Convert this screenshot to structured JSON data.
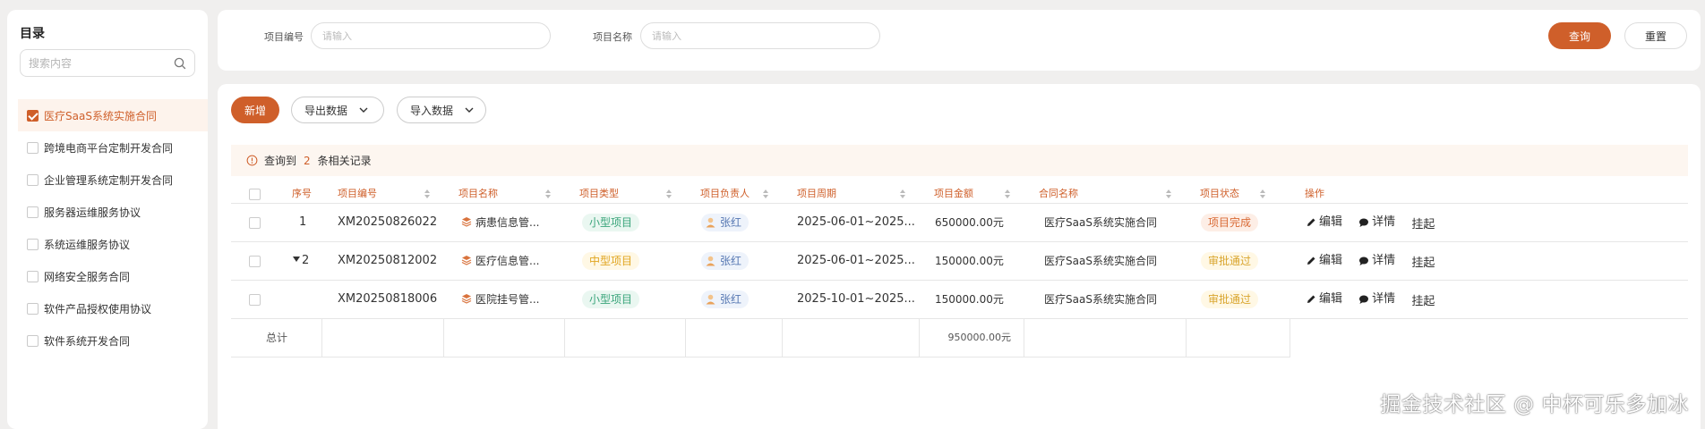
{
  "sidebar": {
    "title": "目录",
    "search_placeholder": "搜索内容",
    "items": [
      {
        "label": "医疗SaaS系统实施合同",
        "checked": true
      },
      {
        "label": "跨境电商平台定制开发合同",
        "checked": false
      },
      {
        "label": "企业管理系统定制开发合同",
        "checked": false
      },
      {
        "label": "服务器运维服务协议",
        "checked": false
      },
      {
        "label": "系统运维服务协议",
        "checked": false
      },
      {
        "label": "网络安全服务合同",
        "checked": false
      },
      {
        "label": "软件产品授权使用协议",
        "checked": false
      },
      {
        "label": "软件系统开发合同",
        "checked": false
      }
    ]
  },
  "filters": {
    "code_label": "项目编号",
    "code_placeholder": "请输入",
    "name_label": "项目名称",
    "name_placeholder": "请输入",
    "query_label": "查询",
    "reset_label": "重置"
  },
  "toolbar": {
    "add_label": "新增",
    "export_label": "导出数据",
    "import_label": "导入数据"
  },
  "info": {
    "prefix": "查询到",
    "count": "2",
    "suffix": "条相关记录"
  },
  "table": {
    "columns": [
      "序号",
      "项目编号",
      "项目名称",
      "项目类型",
      "项目负责人",
      "项目周期",
      "项目金额",
      "合同名称",
      "项目状态",
      "操作"
    ],
    "rows": [
      {
        "index": "1",
        "expanded": false,
        "code": "XM20250826022",
        "name": "病患信息管...",
        "type": "小型项目",
        "owner": "张红",
        "period": "2025-06-01~2025...",
        "amount": "650000.00元",
        "contract": "医疗SaaS系统实施合同",
        "status": "项目完成"
      },
      {
        "index": "2",
        "expanded": true,
        "code": "XM20250812002",
        "name": "医疗信息管...",
        "type": "中型项目",
        "owner": "张红",
        "period": "2025-06-01~2025...",
        "amount": "150000.00元",
        "contract": "医疗SaaS系统实施合同",
        "status": "审批通过"
      },
      {
        "index": "",
        "expanded": false,
        "code": "XM20250818006",
        "name": "医院挂号管...",
        "type": "小型项目",
        "owner": "张红",
        "period": "2025-10-01~2025...",
        "amount": "150000.00元",
        "contract": "医疗SaaS系统实施合同",
        "status": "审批通过"
      }
    ],
    "actions": {
      "edit": "编辑",
      "detail": "详情",
      "suspend": "挂起"
    },
    "total_label": "总计",
    "total_amount": "950000.00元"
  },
  "colors": {
    "accent": "#cf5f2a",
    "tag_small": "#3aa57b",
    "tag_mid": "#e0a520",
    "tag_done": "#d96a35"
  },
  "watermark": "掘金技术社区 @ 中杯可乐多加冰"
}
